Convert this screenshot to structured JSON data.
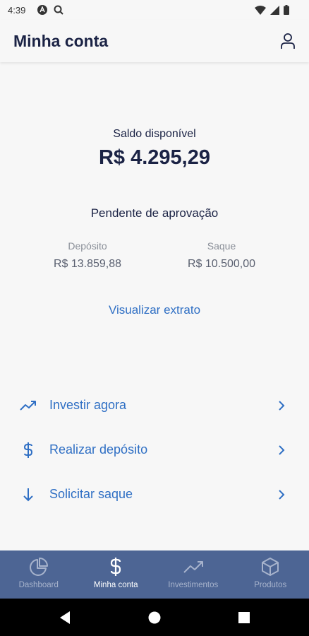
{
  "status_bar": {
    "time": "4:39"
  },
  "header": {
    "title": "Minha conta"
  },
  "balance": {
    "label": "Saldo disponível",
    "value": "R$ 4.295,29"
  },
  "pending": {
    "title": "Pendente de aprovação",
    "deposit_label": "Depósito",
    "deposit_value": "R$ 13.859,88",
    "withdraw_label": "Saque",
    "withdraw_value": "R$ 10.500,00"
  },
  "statement_link": "Visualizar extrato",
  "actions": [
    {
      "label": "Investir agora",
      "icon": "trending-up-icon"
    },
    {
      "label": "Realizar depósito",
      "icon": "dollar-icon"
    },
    {
      "label": "Solicitar saque",
      "icon": "arrow-down-icon"
    }
  ],
  "bottom_nav": [
    {
      "label": "Dashboard",
      "icon": "pie-chart-icon",
      "active": false
    },
    {
      "label": "Minha conta",
      "icon": "dollar-icon",
      "active": true
    },
    {
      "label": "Investimentos",
      "icon": "trending-up-icon",
      "active": false
    },
    {
      "label": "Produtos",
      "icon": "box-icon",
      "active": false
    }
  ],
  "colors": {
    "primary_text": "#1b2345",
    "link_blue": "#2f6fc4",
    "nav_background": "#4d6594",
    "background": "#f7f7f7"
  }
}
